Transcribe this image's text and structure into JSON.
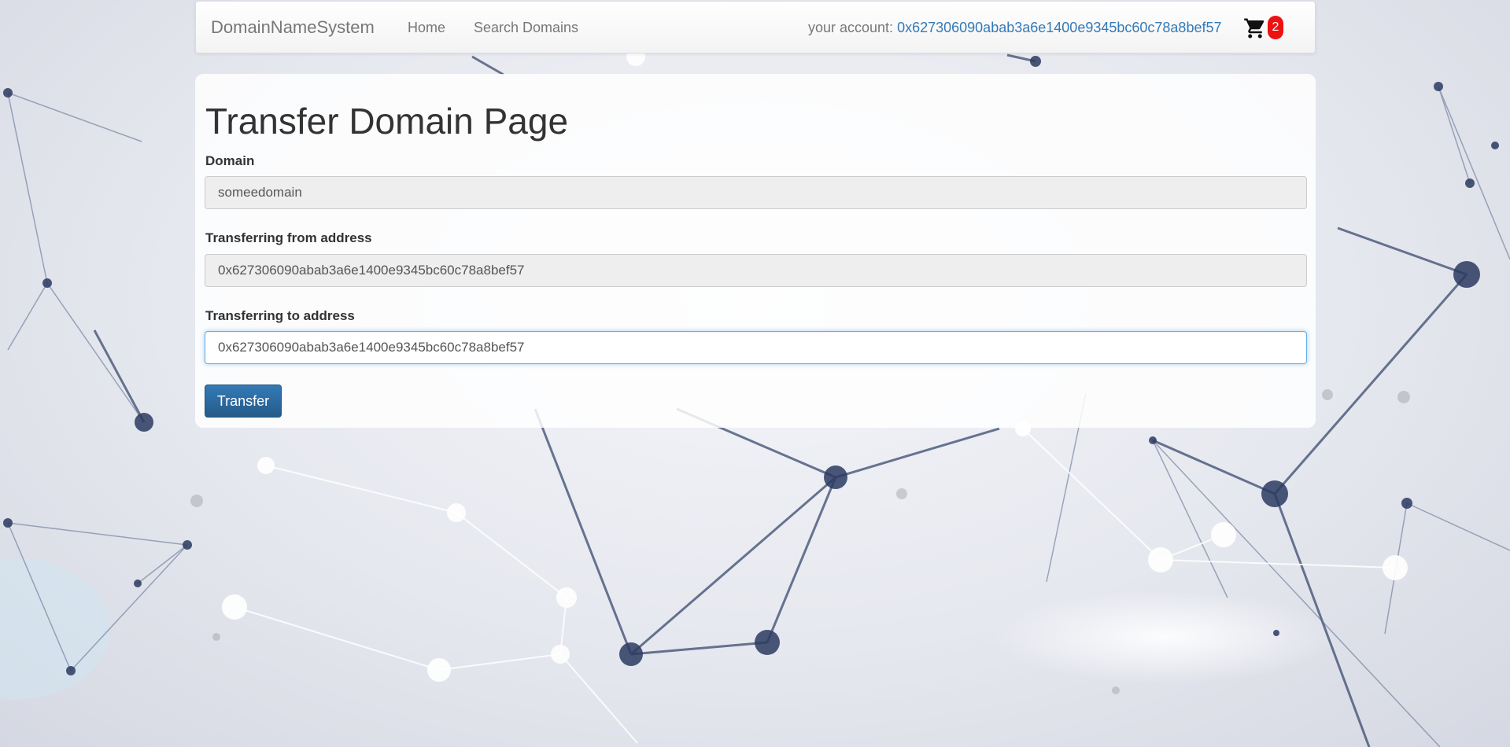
{
  "navbar": {
    "brand": "DomainNameSystem",
    "links": [
      "Home",
      "Search Domains"
    ],
    "account_label": "your account:",
    "account_address": "0x627306090abab3a6e1400e9345bc60c78a8bef57",
    "cart_count": "2"
  },
  "transfer_form": {
    "title": "Transfer Domain Page",
    "domain_label": "Domain",
    "domain_value": "someedomain",
    "from_label": "Transferring from address",
    "from_value": "0x627306090abab3a6e1400e9345bc60c78a8bef57",
    "to_label": "Transferring to address",
    "to_value": "0x627306090abab3a6e1400e9345bc60c78a8bef57",
    "submit_label": "Transfer"
  },
  "icons": {
    "cart": "shopping-cart-icon"
  },
  "colors": {
    "link": "#337ab7",
    "primary_button": "#2e6da4",
    "badge": "#ee1111",
    "focus_border": "#66afe9"
  }
}
